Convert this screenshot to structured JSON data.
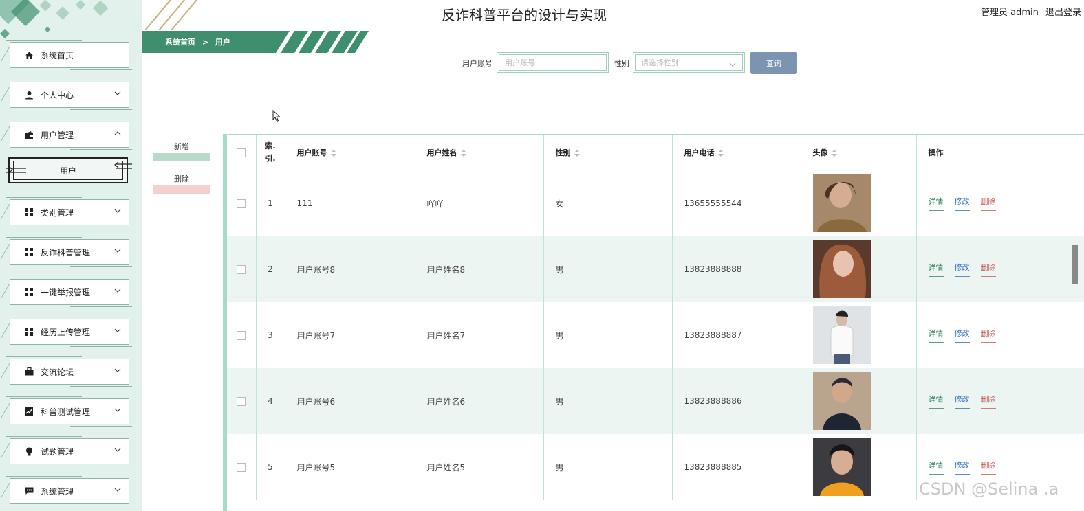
{
  "header": {
    "title": "反诈科普平台的设计与实现",
    "user_label": "管理员 admin",
    "logout": "退出登录"
  },
  "breadcrumb": {
    "home": "系统首页",
    "separator": ">",
    "current": "用户"
  },
  "sidebar": {
    "items": [
      {
        "label": "系统首页",
        "icon": "home-icon"
      },
      {
        "label": "个人中心",
        "icon": "person-icon"
      },
      {
        "label": "用户管理",
        "icon": "wallet-icon"
      },
      {
        "label": "类别管理",
        "icon": "grid-icon"
      },
      {
        "label": "反诈科普管理",
        "icon": "grid-icon"
      },
      {
        "label": "一键举报管理",
        "icon": "grid-icon"
      },
      {
        "label": "经历上传管理",
        "icon": "grid-icon"
      },
      {
        "label": "交流论坛",
        "icon": "briefcase-icon"
      },
      {
        "label": "科普测试管理",
        "icon": "chart-icon"
      },
      {
        "label": "试题管理",
        "icon": "bulb-icon"
      },
      {
        "label": "系统管理",
        "icon": "message-icon"
      }
    ],
    "submenu_active": "用户"
  },
  "search": {
    "account_label": "用户账号",
    "account_placeholder": "用户账号",
    "gender_label": "性别",
    "gender_placeholder": "请选择性别",
    "button": "查询"
  },
  "actions": {
    "add": "新增",
    "delete": "删除"
  },
  "table": {
    "headers": {
      "index_line1": "索.",
      "index_line2": "引.",
      "account": "用户账号",
      "name": "用户姓名",
      "gender": "性别",
      "phone": "用户电话",
      "avatar": "头像",
      "ops": "操作"
    },
    "ops": {
      "detail": "详情",
      "edit": "修改",
      "delete": "删除"
    },
    "rows": [
      {
        "index": "1",
        "account": "111",
        "name": "吖吖",
        "gender": "女",
        "phone": "13655555544"
      },
      {
        "index": "2",
        "account": "用户账号8",
        "name": "用户姓名8",
        "gender": "男",
        "phone": "13823888888"
      },
      {
        "index": "3",
        "account": "用户账号7",
        "name": "用户姓名7",
        "gender": "男",
        "phone": "13823888887"
      },
      {
        "index": "4",
        "account": "用户账号6",
        "name": "用户姓名6",
        "gender": "男",
        "phone": "13823888886"
      },
      {
        "index": "5",
        "account": "用户账号5",
        "name": "用户姓名5",
        "gender": "男",
        "phone": "13823888885"
      }
    ]
  },
  "watermark": "CSDN @Selina .a",
  "colors": {
    "brand_green": "#3f8f6e",
    "sidebar_bg": "#e3f1ec",
    "search_button": "#7b95b1",
    "alt_row": "#ecf5f2"
  }
}
